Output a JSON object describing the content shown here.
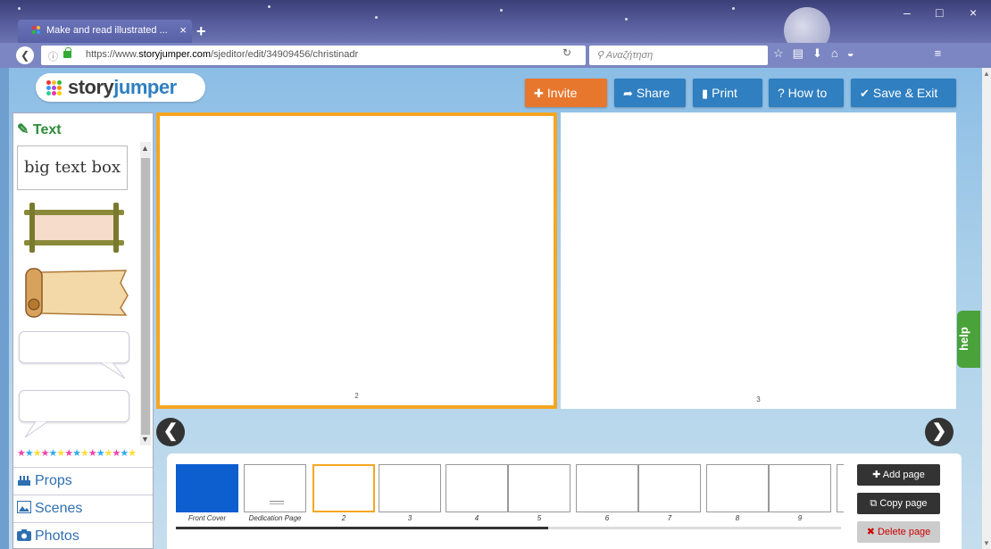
{
  "browser": {
    "tab_title": "Make and read illustrated ...",
    "tab_close": "×",
    "new_tab": "+",
    "url_prefix": "https://www.",
    "url_domain": "storyjumper.com",
    "url_path": "/sjeditor/edit/34909456/christinadr",
    "search_placeholder": "Αναζήτηση",
    "minimize": "–",
    "maximize": "□",
    "close": "×"
  },
  "app": {
    "logo_left": "story",
    "logo_right": "jumper",
    "buttons": {
      "invite": "Invite",
      "share": "Share",
      "print": "Print",
      "howto": "? How to",
      "save": "Save & Exit"
    },
    "colors": {
      "orange": "#e8772e",
      "blue": "#2f7fc1",
      "green": "#4aa23a",
      "cover": "#0d5ecf",
      "selected": "#f5a623"
    }
  },
  "sidebar": {
    "heading": "Text",
    "big_text_box": "big text box",
    "categories": {
      "props": "Props",
      "scenes": "Scenes",
      "photos": "Photos"
    }
  },
  "pages": {
    "left_number": "2",
    "right_number": "3"
  },
  "help_tab": "help",
  "strip": {
    "thumbnails": [
      {
        "label": "Front Cover"
      },
      {
        "label": "Dedication Page"
      },
      {
        "label": "2"
      },
      {
        "label": "3"
      },
      {
        "label": "4"
      },
      {
        "label": "5"
      },
      {
        "label": "6"
      },
      {
        "label": "7"
      },
      {
        "label": "8"
      },
      {
        "label": "9"
      }
    ],
    "scroll_fraction": 0.56,
    "add_page": "Add page",
    "copy_page": "Copy page",
    "delete_page": "Delete page"
  }
}
